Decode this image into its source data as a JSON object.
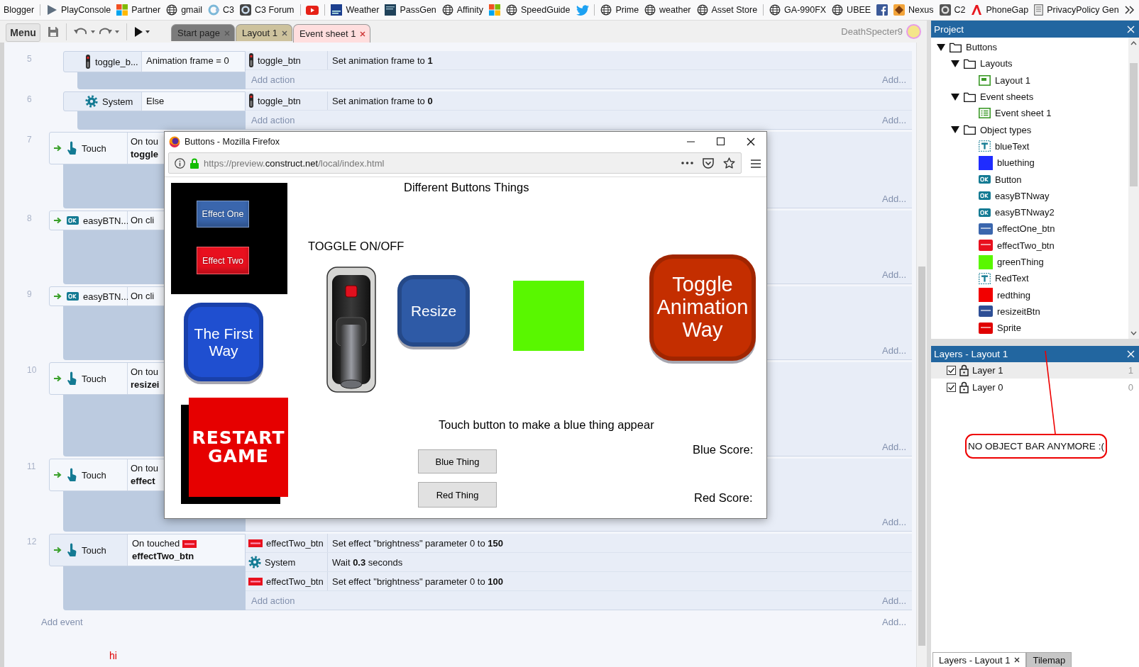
{
  "bookmarks": [
    {
      "kind": "link",
      "label": "Blogger"
    },
    {
      "kind": "separator"
    },
    {
      "kind": "link",
      "label": "PlayConsole"
    },
    {
      "kind": "link",
      "label": "Partner"
    },
    {
      "kind": "link",
      "label": "gmail"
    },
    {
      "kind": "link",
      "label": "C3"
    },
    {
      "kind": "link",
      "label": "C3 Forum"
    },
    {
      "kind": "separator"
    },
    {
      "kind": "link"
    },
    {
      "kind": "separator"
    },
    {
      "kind": "link",
      "label": "Weather"
    },
    {
      "kind": "link",
      "label": "PassGen"
    },
    {
      "kind": "link",
      "label": "Affinity"
    },
    {
      "kind": "link"
    },
    {
      "kind": "link",
      "label": "SpeedGuide"
    },
    {
      "kind": "link"
    },
    {
      "kind": "separator"
    },
    {
      "kind": "link",
      "label": "Prime"
    },
    {
      "kind": "link",
      "label": "weather"
    },
    {
      "kind": "link",
      "label": "Asset Store"
    },
    {
      "kind": "separator"
    },
    {
      "kind": "link",
      "label": "GA-990FX"
    },
    {
      "kind": "link",
      "label": "UBEE"
    },
    {
      "kind": "link"
    },
    {
      "kind": "link",
      "label": "Nexus"
    },
    {
      "kind": "link",
      "label": "C2"
    },
    {
      "kind": "link",
      "label": "PhoneGap"
    },
    {
      "kind": "link",
      "label": "PrivacyPolicy Gen"
    }
  ],
  "toolbar": {
    "menu": "Menu",
    "tabs": [
      {
        "label": "Start page",
        "selected": false,
        "color": "#7b7b7b"
      },
      {
        "label": "Layout 1",
        "selected": false,
        "color": "#cdc29d"
      },
      {
        "label": "Event sheet 1",
        "selected": true,
        "color": "#ffdede"
      }
    ],
    "user": "DeathSpecter9"
  },
  "events": [
    {
      "number": "5",
      "kind": "sub",
      "trigger": false,
      "object": "toggle_b...",
      "condition": "Animation frame = 0",
      "actions": [
        {
          "object": "toggle_btn",
          "text": "Set animation frame to **1**"
        }
      ],
      "add_action": "Add action",
      "add_more": "Add..."
    },
    {
      "number": "6",
      "kind": "sub",
      "trigger": false,
      "object": "System",
      "condition": "Else",
      "actions": [
        {
          "object": "toggle_btn",
          "text": "Set animation frame to **0**"
        }
      ],
      "add_action": "Add action",
      "add_more": "Add..."
    },
    {
      "number": "7",
      "kind": "top",
      "trigger": true,
      "object": "Touch",
      "condition": "On tou",
      "condition_object": "toggle",
      "add_more": "Add..."
    },
    {
      "number": "8",
      "kind": "top",
      "trigger": true,
      "object": "easyBTN...",
      "condition": "On cli",
      "add_more": "Add..."
    },
    {
      "number": "9",
      "kind": "top",
      "trigger": true,
      "object": "easyBTN...",
      "condition": "On cli",
      "add_more": "Add..."
    },
    {
      "number": "10",
      "kind": "top",
      "trigger": true,
      "object": "Touch",
      "condition": "On tou",
      "condition_object": "resizei",
      "add_more": "Add..."
    },
    {
      "number": "11",
      "kind": "top",
      "trigger": true,
      "object": "Touch",
      "condition": "On tou",
      "condition_object": "effect",
      "add_more": "Add..."
    },
    {
      "number": "12",
      "kind": "top",
      "trigger": true,
      "object": "Touch",
      "condition": "On touched",
      "condition_object": "effectTwo_btn",
      "actions": [
        {
          "object": "effectTwo_btn",
          "text": "Set effect \"brightness\" parameter 0 to **150**"
        },
        {
          "object": "System",
          "text": "Wait **0.3** seconds"
        },
        {
          "object": "effectTwo_btn",
          "text": "Set effect \"brightness\" parameter 0 to **100**"
        }
      ],
      "add_action": "Add action",
      "add_more": "Add..."
    }
  ],
  "add_event": {
    "label": "Add event",
    "more": "Add..."
  },
  "sheet_note": "hi",
  "browser": {
    "title": "Buttons - Mozilla Firefox",
    "url": [
      "https://preview.",
      "construct.net",
      "/local/index.html"
    ],
    "objects": [
      {
        "kind": "panel",
        "children": [
          {
            "kind": "bevel-button",
            "color": "#3a66ad",
            "label": "Effect One"
          },
          {
            "kind": "bevel-button",
            "color": "#e8101e",
            "label": "Effect Two"
          }
        ]
      },
      {
        "kind": "text",
        "text": "Different Buttons Things"
      },
      {
        "kind": "text",
        "text": "TOGGLE ON/OFF"
      },
      {
        "kind": "switch"
      },
      {
        "kind": "rounded-button",
        "color": "#2e5aa6",
        "label": "Resize"
      },
      {
        "kind": "block",
        "color": "#59f700"
      },
      {
        "kind": "rounded-button",
        "color": "#c42e00",
        "label": "Toggle Animation Way"
      },
      {
        "kind": "rounded-button",
        "color": "#1f4fd0",
        "label": "The First Way"
      },
      {
        "kind": "restart-button",
        "label": "RESTART GAME"
      },
      {
        "kind": "text",
        "text": "Touch button to make a blue thing appear"
      },
      {
        "kind": "form-button",
        "label": "Blue Thing"
      },
      {
        "kind": "form-button",
        "label": "Red Thing"
      },
      {
        "kind": "text",
        "text": "Blue Score:"
      },
      {
        "kind": "text",
        "text": "Red Score:"
      }
    ]
  },
  "project": {
    "title": "Project",
    "tree": [
      {
        "label": "Buttons",
        "kind": "folder",
        "expanded": true,
        "children": [
          {
            "label": "Layouts",
            "kind": "folder",
            "expanded": true,
            "children": [
              {
                "label": "Layout 1",
                "kind": "layout"
              }
            ]
          },
          {
            "label": "Event sheets",
            "kind": "folder",
            "expanded": true,
            "children": [
              {
                "label": "Event sheet 1",
                "kind": "eventsheet"
              }
            ]
          },
          {
            "label": "Object types",
            "kind": "folder",
            "expanded": true,
            "children": [
              {
                "label": "blueText",
                "kind": "text"
              },
              {
                "label": "bluething",
                "kind": "solid",
                "color": "#1f2cff"
              },
              {
                "label": "Button",
                "kind": "button"
              },
              {
                "label": "easyBTNway",
                "kind": "button"
              },
              {
                "label": "easyBTNway2",
                "kind": "button"
              },
              {
                "label": "effectOne_btn",
                "kind": "sprite",
                "color": "#3a66ad"
              },
              {
                "label": "effectTwo_btn",
                "kind": "sprite",
                "color": "#e8101e"
              },
              {
                "label": "greenThing",
                "kind": "solid",
                "color": "#59f700"
              },
              {
                "label": "RedText",
                "kind": "text"
              },
              {
                "label": "redthing",
                "kind": "solid",
                "color": "#f20000"
              },
              {
                "label": "resizeitBtn",
                "kind": "sprite",
                "color": "#2e4f96"
              },
              {
                "label": "Sprite",
                "kind": "sprite",
                "color": "#e00000"
              }
            ]
          }
        ]
      }
    ]
  },
  "layers": {
    "title": "Layers - Layout 1",
    "rows": [
      {
        "name": "Layer 1",
        "number": "1",
        "visible": true,
        "selected": true
      },
      {
        "name": "Layer 0",
        "number": "0",
        "visible": true,
        "selected": false
      }
    ]
  },
  "annotation": "NO OBJECT BAR ANYMORE :(",
  "bottom_tabs": [
    {
      "label": "Layers - Layout 1",
      "selected": true,
      "closable": true
    },
    {
      "label": "Tilemap",
      "selected": false,
      "closable": false
    }
  ]
}
